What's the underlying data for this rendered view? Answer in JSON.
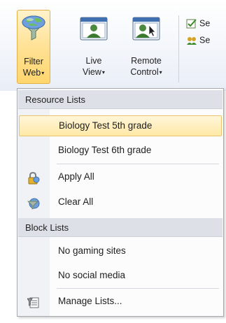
{
  "ribbon": {
    "filter_web": {
      "line1": "Filter",
      "line2": "Web",
      "caret": "▾"
    },
    "live_view": {
      "line1": "Live",
      "line2": "View",
      "caret": "▾"
    },
    "remote_control": {
      "line1": "Remote",
      "line2": "Control",
      "caret": "▾"
    },
    "mini_items": [
      "Se",
      "Se"
    ]
  },
  "menu": {
    "resource_header": "Resource Lists",
    "resource_items": [
      "Biology Test 5th grade",
      "Biology Test 6th grade"
    ],
    "apply_all": "Apply All",
    "clear_all": "Clear All",
    "block_header": "Block Lists",
    "block_items": [
      "No gaming sites",
      "No social media"
    ],
    "manage_lists": "Manage Lists..."
  },
  "colors": {
    "highlight": "#ffe9a8",
    "highlight_border": "#e8c46a",
    "section_header": "#dde1e7"
  }
}
